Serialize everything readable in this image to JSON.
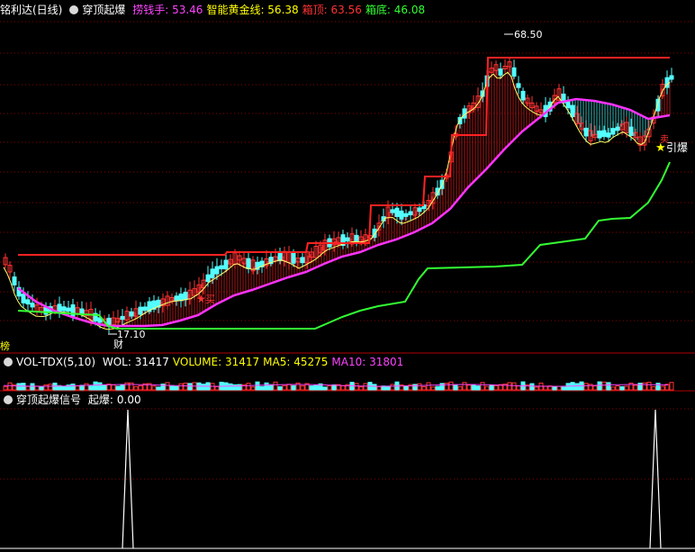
{
  "main_header": {
    "stock_name": "铭利达(日线)",
    "indicator_name": "穿顶起爆",
    "items": [
      {
        "label": "捞钱手:",
        "value": "53.46",
        "color": "#ff44ff"
      },
      {
        "label": "智能黄金线:",
        "value": "56.38",
        "color": "#ffff00"
      },
      {
        "label": "箱顶:",
        "value": "63.56",
        "color": "#ff3333"
      },
      {
        "label": "箱底:",
        "value": "46.08",
        "color": "#33ff33"
      }
    ]
  },
  "annotations": {
    "high_price": "68.50",
    "low_price": "17.10",
    "buy_label": "买",
    "sell_label": "卖",
    "detonate_label": "引爆",
    "fin_label": "财",
    "left_tag": "榜"
  },
  "vol_header": {
    "name": "VOL-TDX(5,10)",
    "items": [
      {
        "label": "WOL:",
        "value": "31417",
        "color": "#ffffff"
      },
      {
        "label": "VOLUME:",
        "value": "31417",
        "color": "#ffff00"
      },
      {
        "label": "MA5:",
        "value": "45275",
        "color": "#ffff00"
      },
      {
        "label": "MA10:",
        "value": "31801",
        "color": "#ff44ff"
      }
    ]
  },
  "signal_header": {
    "name": "穿顶起爆信号",
    "label": "起爆:",
    "value": "0.00"
  },
  "colors": {
    "up": "#ff3333",
    "down": "#54ffff",
    "ma_line": "#ffff66",
    "money_line": "#ff33ff",
    "box_top": "#ff2222",
    "box_bottom": "#33ff33",
    "grid": "#8b0000"
  }
}
